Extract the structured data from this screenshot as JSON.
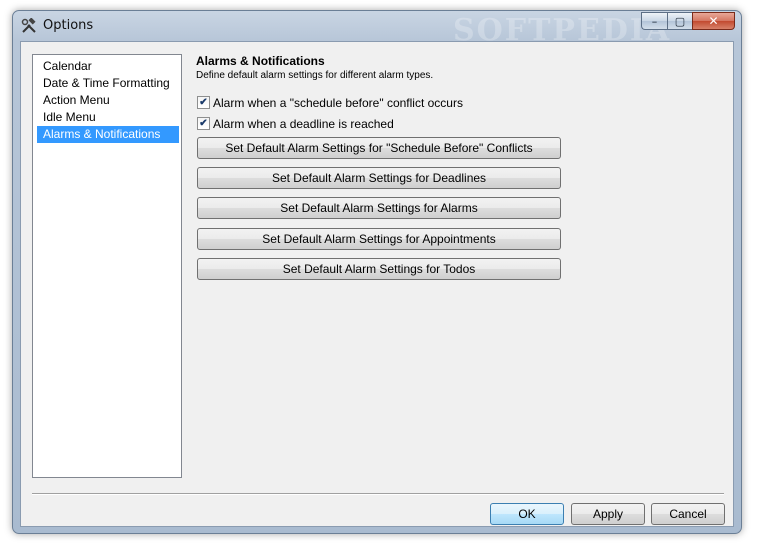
{
  "window": {
    "title": "Options",
    "title_icon": "tools-icon",
    "watermark": "SOFTPEDIA",
    "caption": {
      "minimize": "–",
      "maximize": "▢",
      "close": "✕"
    }
  },
  "nav": {
    "items": [
      {
        "label": "Calendar",
        "selected": false
      },
      {
        "label": "Date & Time Formatting",
        "selected": false
      },
      {
        "label": "Action Menu",
        "selected": false
      },
      {
        "label": "Idle Menu",
        "selected": false
      },
      {
        "label": "Alarms & Notifications",
        "selected": true
      }
    ]
  },
  "section": {
    "title": "Alarms & Notifications",
    "description": "Define default alarm settings for different alarm types."
  },
  "options": {
    "schedule_conflict": {
      "label": "Alarm when a \"schedule before\" conflict occurs",
      "checked": true
    },
    "deadline_reached": {
      "label": "Alarm when a deadline is reached",
      "checked": true
    }
  },
  "buttons": {
    "schedule_before": "Set Default Alarm Settings for \"Schedule Before\" Conflicts",
    "deadlines": "Set Default Alarm Settings for Deadlines",
    "alarms": "Set Default Alarm Settings for Alarms",
    "appointments": "Set Default Alarm Settings for Appointments",
    "todos": "Set Default Alarm Settings for Todos"
  },
  "footer": {
    "ok": "OK",
    "apply": "Apply",
    "cancel": "Cancel"
  },
  "colors": {
    "selection": "#3399ff",
    "client_background": "#f0f0f0"
  }
}
